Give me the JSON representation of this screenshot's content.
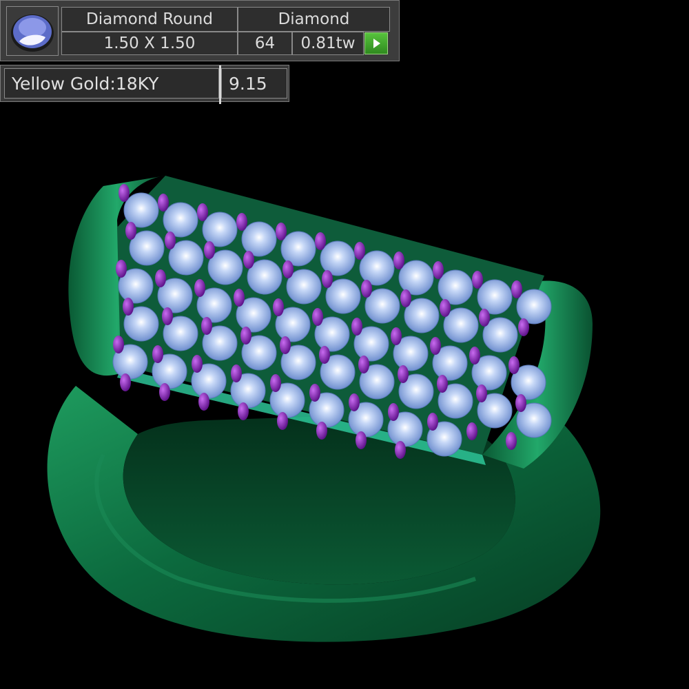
{
  "stone": {
    "shape_name": "Diamond Round",
    "material": "Diamond",
    "size": "1.50 X 1.50",
    "count": "64",
    "weight": "0.81tw"
  },
  "metal": {
    "name": "Yellow Gold:18KY",
    "weight": "9.15"
  },
  "colors": {
    "band": "#0e6a3e",
    "stones": "#8fb0e8",
    "prongs": "#7a1ea8",
    "background": "#000000",
    "play_button": "#43a82f"
  },
  "icons": [
    "gem-thumbnail-icon",
    "play-icon"
  ]
}
